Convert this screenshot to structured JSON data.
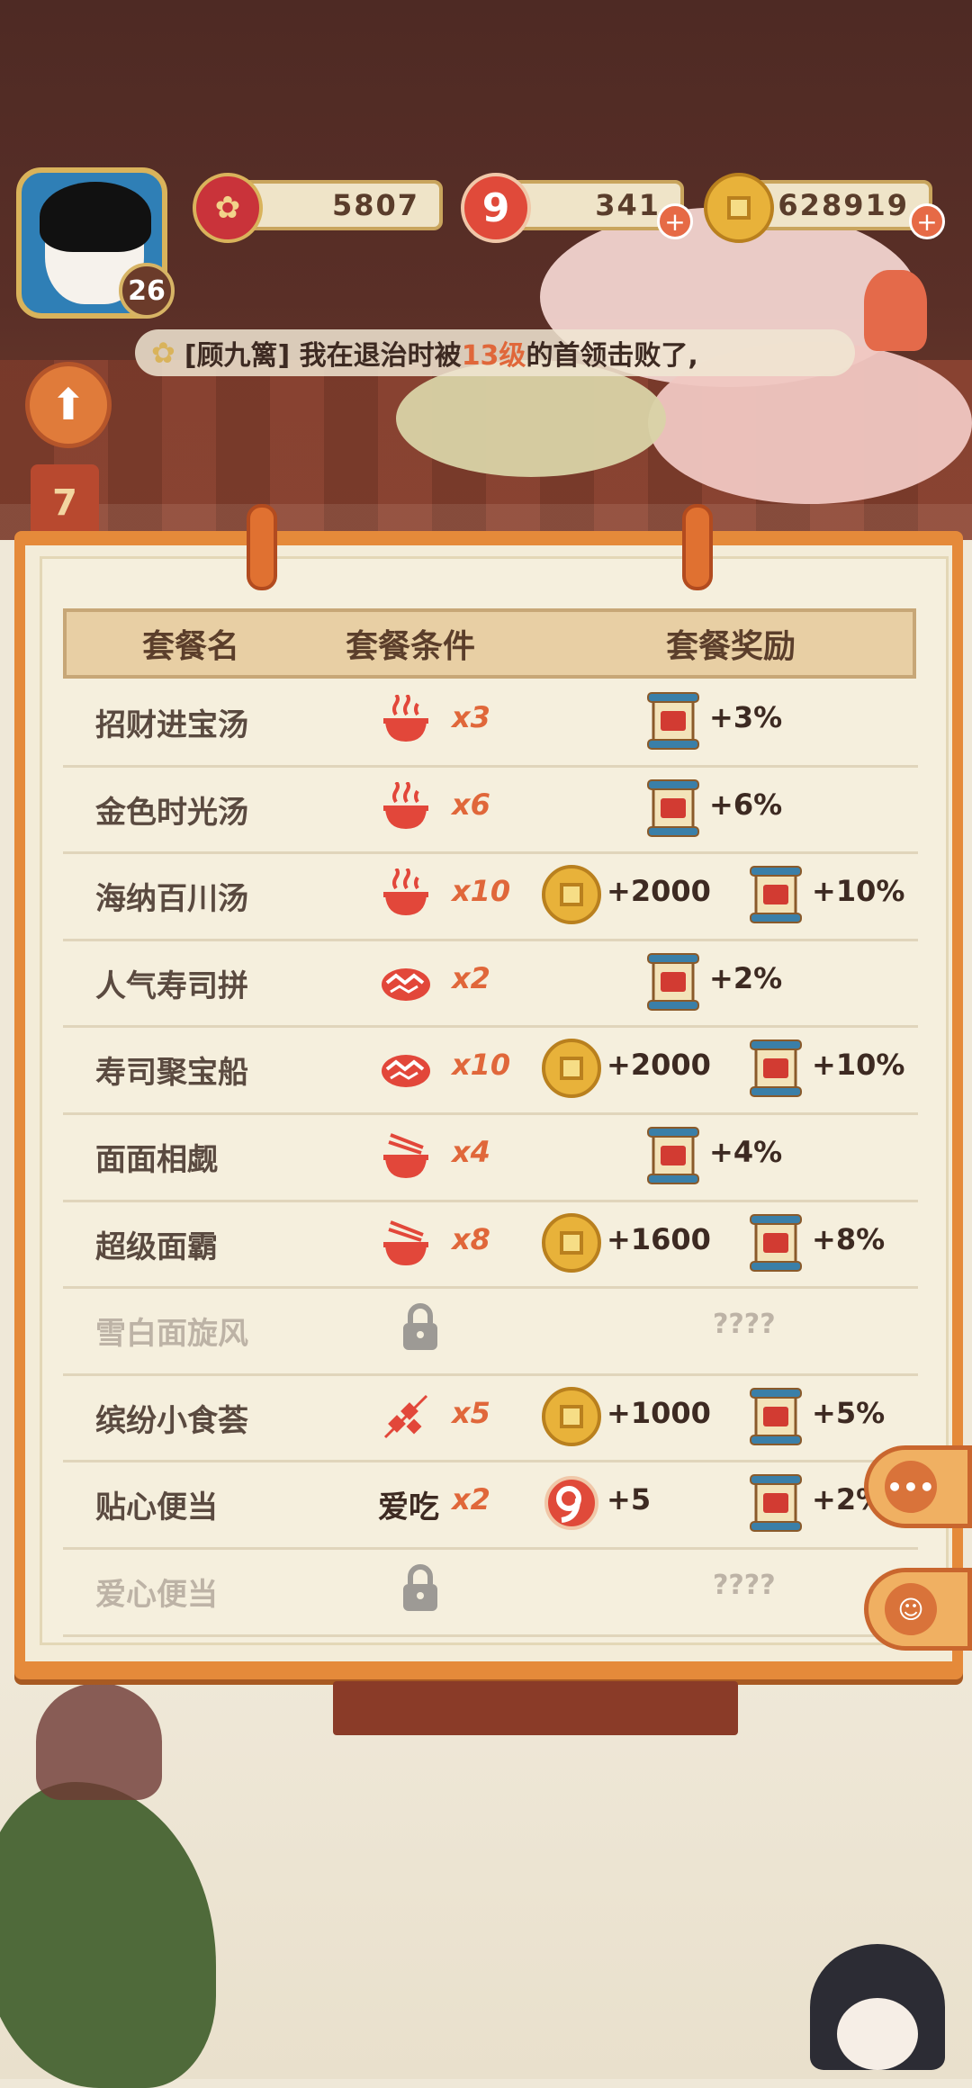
{
  "hud": {
    "level": "26",
    "currency_1": "5807",
    "currency_2": "341",
    "currency_3": "628919",
    "jade_glyph": "9"
  },
  "marquee": {
    "prefix": "[顾九篱] 我在退治时被",
    "highlight": "13级",
    "suffix": "的首领击败了,"
  },
  "day_counter": "7",
  "table": {
    "headers": [
      "套餐名",
      "套餐条件",
      "套餐奖励"
    ],
    "rows": [
      {
        "name": "招财进宝汤",
        "cond_icon": "soup-bowl-icon",
        "mult": "x3",
        "exp": "+3%"
      },
      {
        "name": "金色时光汤",
        "cond_icon": "soup-bowl-icon",
        "mult": "x6",
        "exp": "+6%"
      },
      {
        "name": "海纳百川汤",
        "cond_icon": "soup-bowl-icon",
        "mult": "x10",
        "gold": "+2000",
        "exp": "+10%"
      },
      {
        "name": "人气寿司拼",
        "cond_icon": "sushi-icon",
        "mult": "x2",
        "exp": "+2%"
      },
      {
        "name": "寿司聚宝船",
        "cond_icon": "sushi-icon",
        "mult": "x10",
        "gold": "+2000",
        "exp": "+10%"
      },
      {
        "name": "面面相觑",
        "cond_icon": "noodle-bowl-icon",
        "mult": "x4",
        "exp": "+4%"
      },
      {
        "name": "超级面霸",
        "cond_icon": "noodle-bowl-icon",
        "mult": "x8",
        "gold": "+1600",
        "exp": "+8%"
      },
      {
        "name": "雪白面旋风",
        "locked": true,
        "unknown": "????"
      },
      {
        "name": "缤纷小食荟",
        "cond_icon": "skewer-icon",
        "mult": "x5",
        "gold": "+1000",
        "exp": "+5%"
      },
      {
        "name": "贴心便当",
        "cond_text": "爱吃",
        "mult": "x2",
        "jade": "+5",
        "exp": "+2%"
      },
      {
        "name": "爱心便当",
        "locked": true,
        "unknown": "????"
      }
    ]
  },
  "scroll_label": "经验",
  "colors": {
    "accent": "#e0673a",
    "board": "#e58a3a",
    "paper": "#f5efdd"
  }
}
